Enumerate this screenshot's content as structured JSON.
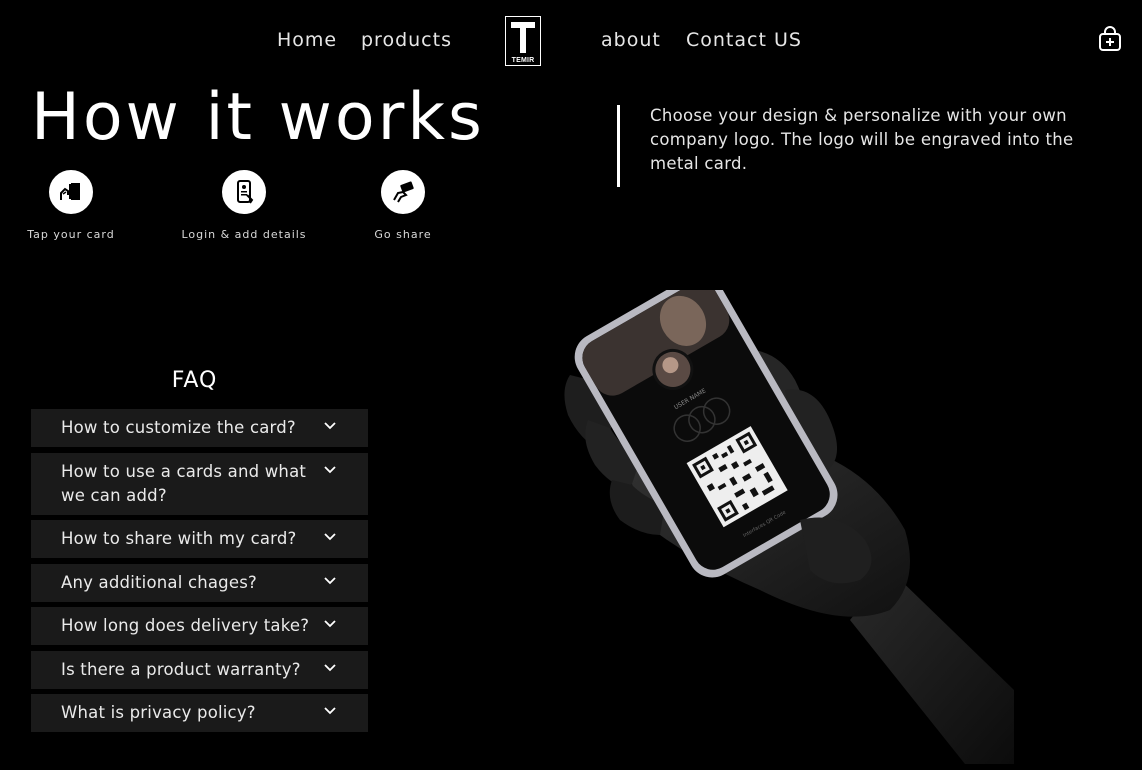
{
  "nav": {
    "links": [
      "Home",
      "products",
      "about",
      "Contact US"
    ],
    "logo_text": "TEMIR",
    "cart_icon": "shopping-bag-plus-icon"
  },
  "hero": {
    "title": "How it works",
    "description": "Choose your design & personalize with your own company logo. The logo will be engraved into the metal card."
  },
  "steps": [
    {
      "label": "Tap your card",
      "icon": "tap-card-icon"
    },
    {
      "label": "Login & add details",
      "icon": "phone-login-icon"
    },
    {
      "label": "Go share",
      "icon": "share-card-icon"
    }
  ],
  "faq": {
    "title": "FAQ",
    "items": [
      "How to customize the card?",
      "How to use a cards and what we can add?",
      "How to share with my card?",
      "Any additional chages?",
      "How long does delivery take?",
      "Is there a product warranty?",
      "What is privacy policy?"
    ]
  },
  "phone_screen": {
    "user_name": "USER NAME",
    "qr_caption": "Interfaces QR Code"
  },
  "colors": {
    "background": "#000000",
    "text": "#ffffff",
    "faq_item_bg": "#1a1a1a"
  }
}
